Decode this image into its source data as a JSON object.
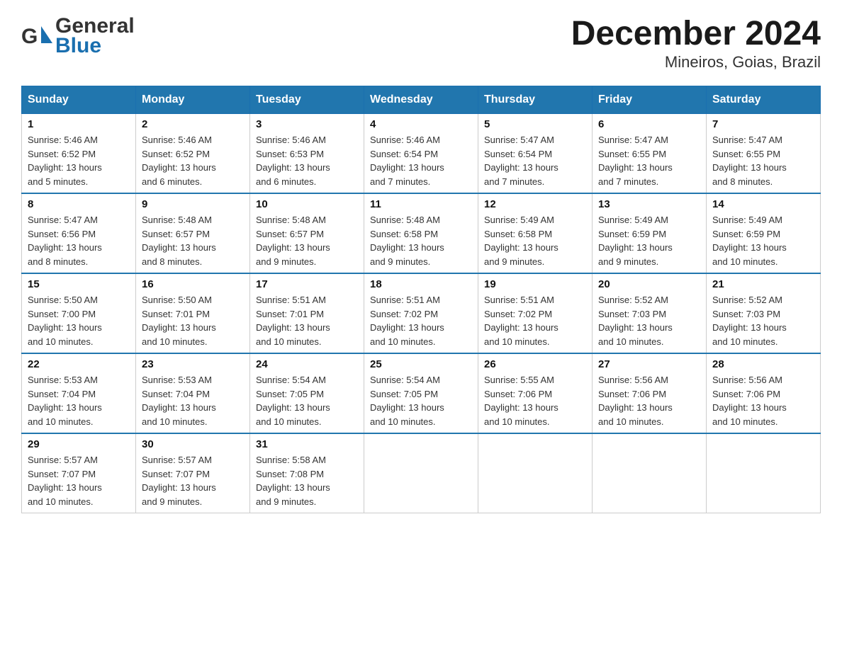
{
  "logo": {
    "general": "General",
    "blue": "Blue"
  },
  "title": "December 2024",
  "subtitle": "Mineiros, Goias, Brazil",
  "days_header": [
    "Sunday",
    "Monday",
    "Tuesday",
    "Wednesday",
    "Thursday",
    "Friday",
    "Saturday"
  ],
  "weeks": [
    [
      {
        "day": "1",
        "sunrise": "5:46 AM",
        "sunset": "6:52 PM",
        "daylight": "13 hours and 5 minutes."
      },
      {
        "day": "2",
        "sunrise": "5:46 AM",
        "sunset": "6:52 PM",
        "daylight": "13 hours and 6 minutes."
      },
      {
        "day": "3",
        "sunrise": "5:46 AM",
        "sunset": "6:53 PM",
        "daylight": "13 hours and 6 minutes."
      },
      {
        "day": "4",
        "sunrise": "5:46 AM",
        "sunset": "6:54 PM",
        "daylight": "13 hours and 7 minutes."
      },
      {
        "day": "5",
        "sunrise": "5:47 AM",
        "sunset": "6:54 PM",
        "daylight": "13 hours and 7 minutes."
      },
      {
        "day": "6",
        "sunrise": "5:47 AM",
        "sunset": "6:55 PM",
        "daylight": "13 hours and 7 minutes."
      },
      {
        "day": "7",
        "sunrise": "5:47 AM",
        "sunset": "6:55 PM",
        "daylight": "13 hours and 8 minutes."
      }
    ],
    [
      {
        "day": "8",
        "sunrise": "5:47 AM",
        "sunset": "6:56 PM",
        "daylight": "13 hours and 8 minutes."
      },
      {
        "day": "9",
        "sunrise": "5:48 AM",
        "sunset": "6:57 PM",
        "daylight": "13 hours and 8 minutes."
      },
      {
        "day": "10",
        "sunrise": "5:48 AM",
        "sunset": "6:57 PM",
        "daylight": "13 hours and 9 minutes."
      },
      {
        "day": "11",
        "sunrise": "5:48 AM",
        "sunset": "6:58 PM",
        "daylight": "13 hours and 9 minutes."
      },
      {
        "day": "12",
        "sunrise": "5:49 AM",
        "sunset": "6:58 PM",
        "daylight": "13 hours and 9 minutes."
      },
      {
        "day": "13",
        "sunrise": "5:49 AM",
        "sunset": "6:59 PM",
        "daylight": "13 hours and 9 minutes."
      },
      {
        "day": "14",
        "sunrise": "5:49 AM",
        "sunset": "6:59 PM",
        "daylight": "13 hours and 10 minutes."
      }
    ],
    [
      {
        "day": "15",
        "sunrise": "5:50 AM",
        "sunset": "7:00 PM",
        "daylight": "13 hours and 10 minutes."
      },
      {
        "day": "16",
        "sunrise": "5:50 AM",
        "sunset": "7:01 PM",
        "daylight": "13 hours and 10 minutes."
      },
      {
        "day": "17",
        "sunrise": "5:51 AM",
        "sunset": "7:01 PM",
        "daylight": "13 hours and 10 minutes."
      },
      {
        "day": "18",
        "sunrise": "5:51 AM",
        "sunset": "7:02 PM",
        "daylight": "13 hours and 10 minutes."
      },
      {
        "day": "19",
        "sunrise": "5:51 AM",
        "sunset": "7:02 PM",
        "daylight": "13 hours and 10 minutes."
      },
      {
        "day": "20",
        "sunrise": "5:52 AM",
        "sunset": "7:03 PM",
        "daylight": "13 hours and 10 minutes."
      },
      {
        "day": "21",
        "sunrise": "5:52 AM",
        "sunset": "7:03 PM",
        "daylight": "13 hours and 10 minutes."
      }
    ],
    [
      {
        "day": "22",
        "sunrise": "5:53 AM",
        "sunset": "7:04 PM",
        "daylight": "13 hours and 10 minutes."
      },
      {
        "day": "23",
        "sunrise": "5:53 AM",
        "sunset": "7:04 PM",
        "daylight": "13 hours and 10 minutes."
      },
      {
        "day": "24",
        "sunrise": "5:54 AM",
        "sunset": "7:05 PM",
        "daylight": "13 hours and 10 minutes."
      },
      {
        "day": "25",
        "sunrise": "5:54 AM",
        "sunset": "7:05 PM",
        "daylight": "13 hours and 10 minutes."
      },
      {
        "day": "26",
        "sunrise": "5:55 AM",
        "sunset": "7:06 PM",
        "daylight": "13 hours and 10 minutes."
      },
      {
        "day": "27",
        "sunrise": "5:56 AM",
        "sunset": "7:06 PM",
        "daylight": "13 hours and 10 minutes."
      },
      {
        "day": "28",
        "sunrise": "5:56 AM",
        "sunset": "7:06 PM",
        "daylight": "13 hours and 10 minutes."
      }
    ],
    [
      {
        "day": "29",
        "sunrise": "5:57 AM",
        "sunset": "7:07 PM",
        "daylight": "13 hours and 10 minutes."
      },
      {
        "day": "30",
        "sunrise": "5:57 AM",
        "sunset": "7:07 PM",
        "daylight": "13 hours and 9 minutes."
      },
      {
        "day": "31",
        "sunrise": "5:58 AM",
        "sunset": "7:08 PM",
        "daylight": "13 hours and 9 minutes."
      },
      null,
      null,
      null,
      null
    ]
  ],
  "labels": {
    "sunrise": "Sunrise:",
    "sunset": "Sunset:",
    "daylight": "Daylight:"
  }
}
